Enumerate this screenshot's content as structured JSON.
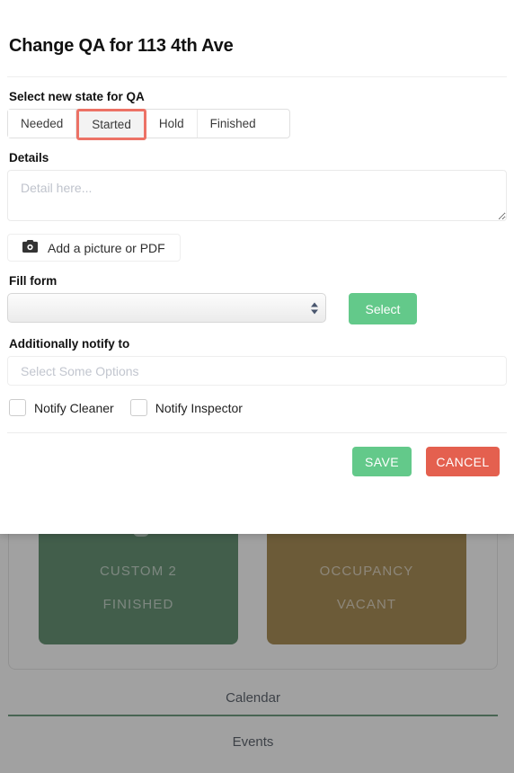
{
  "modal": {
    "title": "Change QA for 113 4th Ave",
    "state_section": {
      "label": "Select new state for QA",
      "options": [
        {
          "label": "Needed",
          "selected": false
        },
        {
          "label": "Started",
          "selected": true
        },
        {
          "label": "Hold",
          "selected": false
        },
        {
          "label": "Finished",
          "selected": false
        }
      ],
      "selected_value": "Started",
      "selected_border_color": "#ec7266"
    },
    "details_section": {
      "label": "Details",
      "placeholder": "Detail here...",
      "value": ""
    },
    "attachment": {
      "button_label": "Add a picture or PDF",
      "icon": "camera-icon"
    },
    "fill_form_section": {
      "label": "Fill form",
      "select_value": "",
      "select_options": [
        ""
      ],
      "select_button_label": "Select",
      "select_button_color": "#63c98a"
    },
    "notify_section": {
      "label": "Additionally notify to",
      "placeholder": "Select Some Options",
      "value": "",
      "checkboxes": [
        {
          "label": "Notify Cleaner",
          "checked": false
        },
        {
          "label": "Notify Inspector",
          "checked": false
        }
      ]
    },
    "footer": {
      "save_label": "SAVE",
      "cancel_label": "CANCEL",
      "save_color": "#63c98a",
      "cancel_color": "#e4604f"
    }
  },
  "background": {
    "cards": [
      {
        "title": "CUSTOM 2",
        "status": "FINISHED",
        "color": "#2e6b40",
        "icon": "gear-icon"
      },
      {
        "title": "OCCUPANCY",
        "status": "VACANT",
        "color": "#8a6418",
        "icon": "bed-icon"
      }
    ],
    "tabs": [
      {
        "label": "Calendar",
        "active": true
      },
      {
        "label": "Events",
        "active": false
      }
    ],
    "active_tab_underline_color": "#3d7a52"
  }
}
